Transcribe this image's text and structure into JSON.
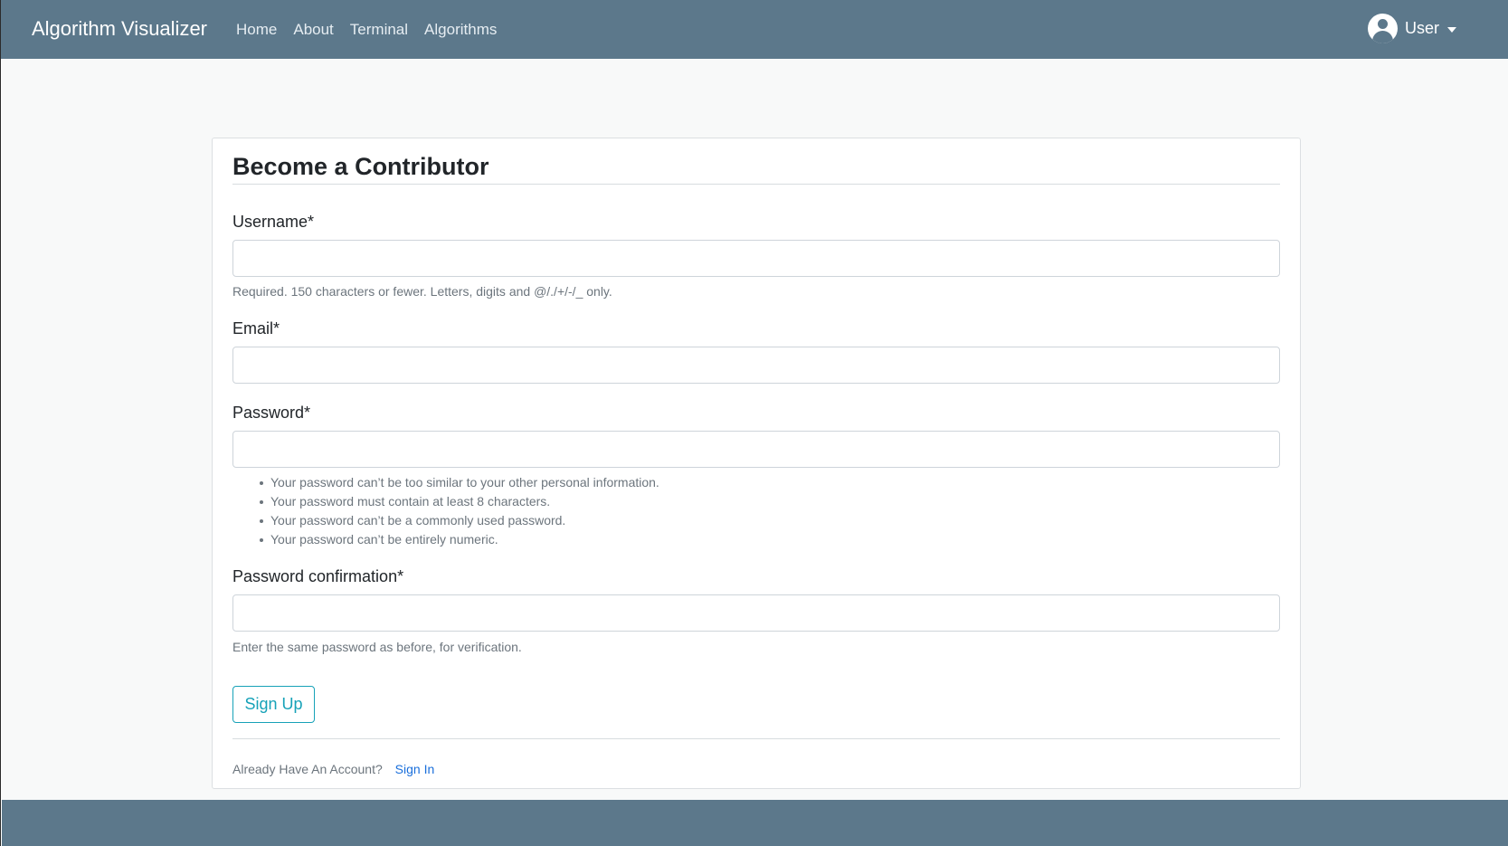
{
  "navbar": {
    "brand": "Algorithm Visualizer",
    "links": [
      "Home",
      "About",
      "Terminal",
      "Algorithms"
    ],
    "user_label": "User",
    "background": "#5c788b"
  },
  "form": {
    "title": "Become a Contributor",
    "username": {
      "label": "Username*",
      "value": "",
      "help": "Required. 150 characters or fewer. Letters, digits and @/./+/-/_ only."
    },
    "email": {
      "label": "Email*",
      "value": ""
    },
    "password": {
      "label": "Password*",
      "value": "",
      "rules": [
        "Your password can’t be too similar to your other personal information.",
        "Your password must contain at least 8 characters.",
        "Your password can’t be a commonly used password.",
        "Your password can’t be entirely numeric."
      ]
    },
    "password_confirmation": {
      "label": "Password confirmation*",
      "value": "",
      "help": "Enter the same password as before, for verification."
    },
    "submit_label": "Sign Up",
    "account_prompt": "Already Have An Account?",
    "signin_label": "Sign In"
  },
  "colors": {
    "accent": "#17a2b8",
    "link": "#1a6fdb"
  },
  "icons": {
    "user": "user-avatar-icon",
    "dropdown": "chevron-down-icon"
  }
}
